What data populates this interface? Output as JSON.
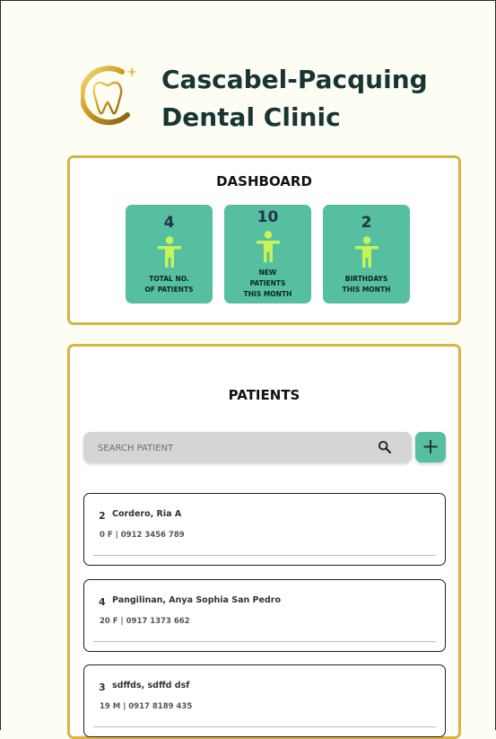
{
  "clinic": {
    "name_line1": "Cascabel-Pacquing",
    "name_line2": "Dental Clinic"
  },
  "dashboard": {
    "title": "DASHBOARD",
    "stats": [
      {
        "value": "4",
        "label_lines": [
          "TOTAL NO.",
          "OF PATIENTS"
        ],
        "icon": "person-icon"
      },
      {
        "value": "10",
        "label_lines": [
          "NEW",
          "PATIENTS",
          "THIS MONTH"
        ],
        "icon": "person-icon"
      },
      {
        "value": "2",
        "label_lines": [
          "BIRTHDAYS",
          "THIS MONTH"
        ],
        "icon": "person-icon"
      }
    ]
  },
  "patients": {
    "title": "PATIENTS",
    "search": {
      "placeholder": "SEARCH PATIENT",
      "value": ""
    },
    "add_label": "+",
    "list": [
      {
        "id": "2",
        "name": "Cordero, Ria A",
        "info": "0 F | 0912 3456 789"
      },
      {
        "id": "4",
        "name": "Pangilinan, Anya Sophia San Pedro",
        "info": "20 F | 0917 1373 662"
      },
      {
        "id": "3",
        "name": "sdffds, sdffd dsf",
        "info": "19 M | 0917 8189 435"
      }
    ]
  },
  "colors": {
    "accent": "#55bfa0",
    "border_gold": "#d8b443",
    "figure": "#c8f25a",
    "title": "#173532"
  }
}
